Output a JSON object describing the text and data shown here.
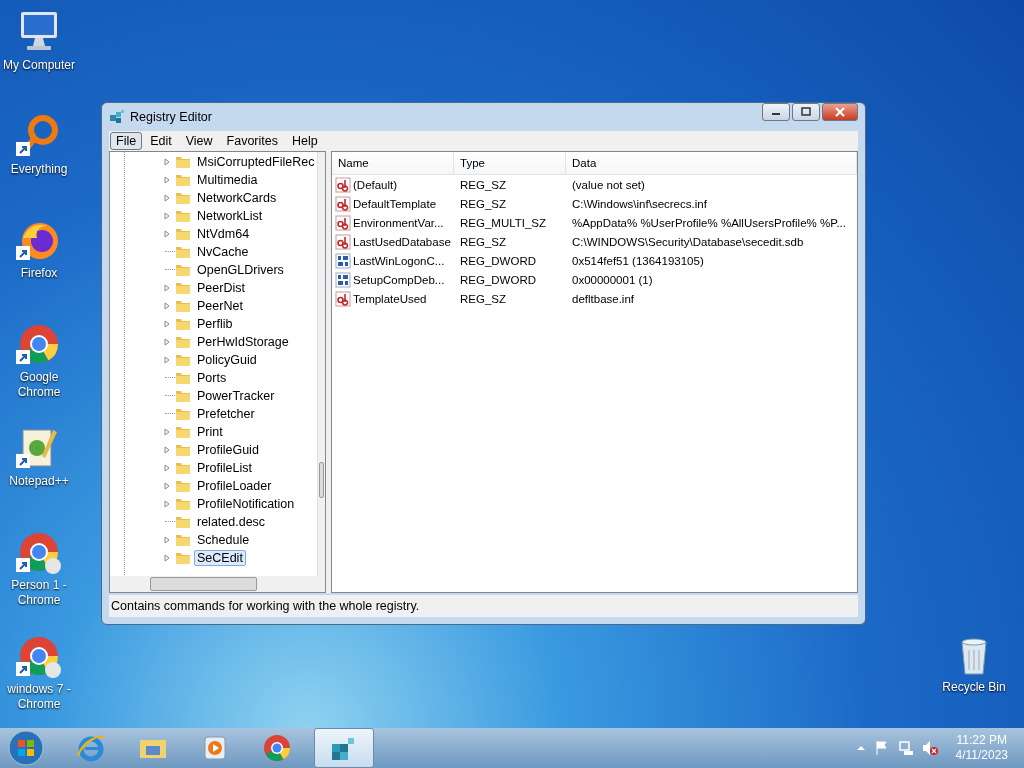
{
  "desktop_icons": [
    {
      "label": "My Computer",
      "kind": "computer",
      "shortcut": false
    },
    {
      "label": "Everything",
      "kind": "everything",
      "shortcut": true
    },
    {
      "label": "Firefox",
      "kind": "firefox",
      "shortcut": true
    },
    {
      "label": "Google Chrome",
      "kind": "chrome",
      "shortcut": true
    },
    {
      "label": "Notepad++",
      "kind": "notepad",
      "shortcut": true
    },
    {
      "label": "Person 1 - Chrome",
      "kind": "chrome-person",
      "shortcut": true
    },
    {
      "label": "windows 7 - Chrome",
      "kind": "chrome-person",
      "shortcut": true
    },
    {
      "label": "Recycle Bin",
      "kind": "recycle",
      "shortcut": false
    }
  ],
  "window": {
    "title": "Registry Editor",
    "menu": [
      {
        "label": "File",
        "selected": true
      },
      {
        "label": "Edit",
        "selected": false
      },
      {
        "label": "View",
        "selected": false
      },
      {
        "label": "Favorites",
        "selected": false
      },
      {
        "label": "Help",
        "selected": false
      }
    ],
    "tree": [
      {
        "label": "MsiCorruptedFileRec",
        "expandable": true,
        "selected": false
      },
      {
        "label": "Multimedia",
        "expandable": true,
        "selected": false
      },
      {
        "label": "NetworkCards",
        "expandable": true,
        "selected": false
      },
      {
        "label": "NetworkList",
        "expandable": true,
        "selected": false
      },
      {
        "label": "NtVdm64",
        "expandable": true,
        "selected": false
      },
      {
        "label": "NvCache",
        "expandable": false,
        "selected": false
      },
      {
        "label": "OpenGLDrivers",
        "expandable": false,
        "selected": false
      },
      {
        "label": "PeerDist",
        "expandable": true,
        "selected": false
      },
      {
        "label": "PeerNet",
        "expandable": true,
        "selected": false
      },
      {
        "label": "Perflib",
        "expandable": true,
        "selected": false
      },
      {
        "label": "PerHwIdStorage",
        "expandable": true,
        "selected": false
      },
      {
        "label": "PolicyGuid",
        "expandable": true,
        "selected": false
      },
      {
        "label": "Ports",
        "expandable": false,
        "selected": false
      },
      {
        "label": "PowerTracker",
        "expandable": false,
        "selected": false
      },
      {
        "label": "Prefetcher",
        "expandable": false,
        "selected": false
      },
      {
        "label": "Print",
        "expandable": true,
        "selected": false
      },
      {
        "label": "ProfileGuid",
        "expandable": true,
        "selected": false
      },
      {
        "label": "ProfileList",
        "expandable": true,
        "selected": false
      },
      {
        "label": "ProfileLoader",
        "expandable": true,
        "selected": false
      },
      {
        "label": "ProfileNotification",
        "expandable": true,
        "selected": false
      },
      {
        "label": "related.desc",
        "expandable": false,
        "selected": false
      },
      {
        "label": "Schedule",
        "expandable": true,
        "selected": false
      },
      {
        "label": "SeCEdit",
        "expandable": true,
        "selected": true
      }
    ],
    "columns": [
      "Name",
      "Type",
      "Data"
    ],
    "values": [
      {
        "kind": "string",
        "name": "(Default)",
        "type": "REG_SZ",
        "data": "(value not set)"
      },
      {
        "kind": "string",
        "name": "DefaultTemplate",
        "type": "REG_SZ",
        "data": "C:\\Windows\\inf\\secrecs.inf"
      },
      {
        "kind": "string",
        "name": "EnvironmentVar...",
        "type": "REG_MULTI_SZ",
        "data": "%AppData% %UserProfile% %AllUsersProfile% %P..."
      },
      {
        "kind": "string",
        "name": "LastUsedDatabase",
        "type": "REG_SZ",
        "data": "C:\\WINDOWS\\Security\\Database\\secedit.sdb"
      },
      {
        "kind": "binary",
        "name": "LastWinLogonC...",
        "type": "REG_DWORD",
        "data": "0x514fef51 (1364193105)"
      },
      {
        "kind": "binary",
        "name": "SetupCompDeb...",
        "type": "REG_DWORD",
        "data": "0x00000001 (1)"
      },
      {
        "kind": "string",
        "name": "TemplateUsed",
        "type": "REG_SZ",
        "data": "defltbase.inf"
      }
    ],
    "status_bar": "Contains commands for working with the whole registry."
  },
  "taskbar": {
    "items": [
      {
        "kind": "ie",
        "selected": false
      },
      {
        "kind": "explorer",
        "selected": false
      },
      {
        "kind": "media",
        "selected": false
      },
      {
        "kind": "chrome",
        "selected": false
      },
      {
        "kind": "regedit",
        "selected": true
      }
    ],
    "time": "11:22 PM",
    "date": "4/11/2023"
  }
}
